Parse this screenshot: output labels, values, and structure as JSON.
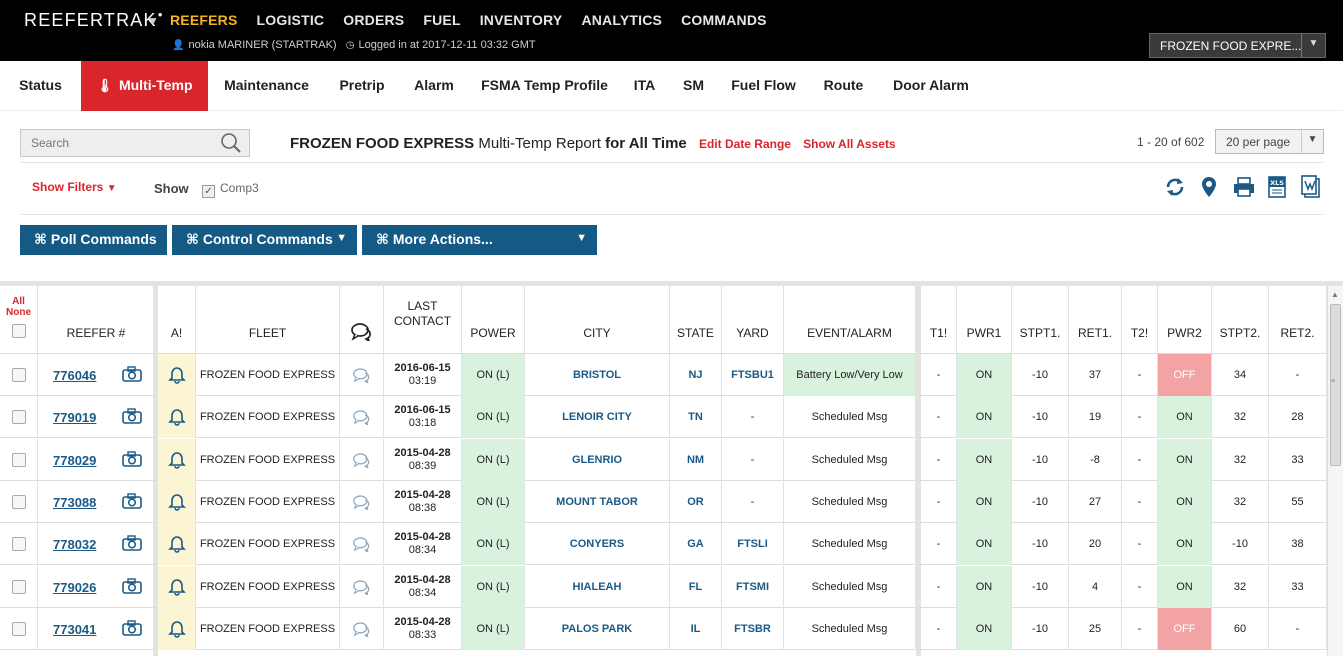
{
  "app": {
    "brand": "REEFERTRAK",
    "nav": [
      "REEFERS",
      "LOGISTIC",
      "ORDERS",
      "FUEL",
      "INVENTORY",
      "ANALYTICS",
      "COMMANDS"
    ],
    "active_nav": "REEFERS",
    "user": "nokia MARINER (STARTRAK)",
    "login": "Logged in at 2017-12-11 03:32 GMT",
    "account": "FROZEN FOOD EXPRE..."
  },
  "tabs": [
    "Status",
    "Multi-Temp",
    "Maintenance",
    "Pretrip",
    "Alarm",
    "FSMA Temp Profile",
    "ITA",
    "SM",
    "Fuel Flow",
    "Route",
    "Door Alarm"
  ],
  "active_tab": "Multi-Temp",
  "controls": {
    "search_placeholder": "Search",
    "report_company": "FROZEN FOOD EXPRESS",
    "report_name": "Multi-Temp Report",
    "report_range": "for All Time",
    "edit_date": "Edit Date Range",
    "show_assets": "Show All Assets",
    "pager": "1 - 20 of 602",
    "per_page": "20 per page",
    "show_filters": "Show Filters",
    "show_label": "Show",
    "comp3": "Comp3",
    "poll": "⌘ Poll Commands",
    "control": "⌘ Control Commands",
    "more": "⌘ More Actions..."
  },
  "table": {
    "select_all": "All",
    "select_none": "None",
    "headers": {
      "reefer": "REEFER #",
      "alarm": "A!",
      "fleet": "FLEET",
      "last_contact_1": "LAST",
      "last_contact_2": "CONTACT",
      "power": "POWER",
      "city": "CITY",
      "state": "STATE",
      "yard": "YARD",
      "event": "EVENT/ALARM",
      "t1": "T1!",
      "pwr1": "PWR1",
      "stpt1": "STPT1.",
      "ret1": "RET1.",
      "t2": "T2!",
      "pwr2": "PWR2",
      "stpt2": "STPT2.",
      "ret2": "RET2."
    },
    "rows": [
      {
        "reefer": "776046",
        "fleet": "FROZEN FOOD EXPRESS",
        "date": "2016-06-15",
        "time": "03:19",
        "power": "ON (L)",
        "city": "BRISTOL",
        "state": "NJ",
        "yard": "FTSBU1",
        "event": "Battery Low/Very Low",
        "event_green": true,
        "t1": "-",
        "pwr1": "ON",
        "stpt1": "-10",
        "ret1": "37",
        "t2": "-",
        "pwr2": "OFF",
        "stpt2": "34",
        "ret2": "-"
      },
      {
        "reefer": "779019",
        "fleet": "FROZEN FOOD EXPRESS",
        "date": "2016-06-15",
        "time": "03:18",
        "power": "ON (L)",
        "city": "LENOIR CITY",
        "state": "TN",
        "yard": "-",
        "event": "Scheduled Msg",
        "event_green": false,
        "t1": "-",
        "pwr1": "ON",
        "stpt1": "-10",
        "ret1": "19",
        "t2": "-",
        "pwr2": "ON",
        "stpt2": "32",
        "ret2": "28"
      },
      {
        "reefer": "778029",
        "fleet": "FROZEN FOOD EXPRESS",
        "date": "2015-04-28",
        "time": "08:39",
        "power": "ON (L)",
        "city": "GLENRIO",
        "state": "NM",
        "yard": "-",
        "event": "Scheduled Msg",
        "event_green": false,
        "t1": "-",
        "pwr1": "ON",
        "stpt1": "-10",
        "ret1": "-8",
        "t2": "-",
        "pwr2": "ON",
        "stpt2": "32",
        "ret2": "33"
      },
      {
        "reefer": "773088",
        "fleet": "FROZEN FOOD EXPRESS",
        "date": "2015-04-28",
        "time": "08:38",
        "power": "ON (L)",
        "city": "MOUNT TABOR",
        "state": "OR",
        "yard": "-",
        "event": "Scheduled Msg",
        "event_green": false,
        "t1": "-",
        "pwr1": "ON",
        "stpt1": "-10",
        "ret1": "27",
        "t2": "-",
        "pwr2": "ON",
        "stpt2": "32",
        "ret2": "55"
      },
      {
        "reefer": "778032",
        "fleet": "FROZEN FOOD EXPRESS",
        "date": "2015-04-28",
        "time": "08:34",
        "power": "ON (L)",
        "city": "CONYERS",
        "state": "GA",
        "yard": "FTSLI",
        "event": "Scheduled Msg",
        "event_green": false,
        "t1": "-",
        "pwr1": "ON",
        "stpt1": "-10",
        "ret1": "20",
        "t2": "-",
        "pwr2": "ON",
        "stpt2": "-10",
        "ret2": "38"
      },
      {
        "reefer": "779026",
        "fleet": "FROZEN FOOD EXPRESS",
        "date": "2015-04-28",
        "time": "08:34",
        "power": "ON (L)",
        "city": "HIALEAH",
        "state": "FL",
        "yard": "FTSMI",
        "event": "Scheduled Msg",
        "event_green": false,
        "t1": "-",
        "pwr1": "ON",
        "stpt1": "-10",
        "ret1": "4",
        "t2": "-",
        "pwr2": "ON",
        "stpt2": "32",
        "ret2": "33"
      },
      {
        "reefer": "773041",
        "fleet": "FROZEN FOOD EXPRESS",
        "date": "2015-04-28",
        "time": "08:33",
        "power": "ON (L)",
        "city": "PALOS PARK",
        "state": "IL",
        "yard": "FTSBR",
        "event": "Scheduled Msg",
        "event_green": false,
        "t1": "-",
        "pwr1": "ON",
        "stpt1": "-10",
        "ret1": "25",
        "t2": "-",
        "pwr2": "OFF",
        "stpt2": "60",
        "ret2": "-"
      }
    ]
  },
  "colors": {
    "accent_red": "#d9262b",
    "nav_active": "#f2b61f",
    "button_blue": "#155a85",
    "green_cell": "#d9f2dd",
    "red_cell": "#f3a3a3"
  }
}
